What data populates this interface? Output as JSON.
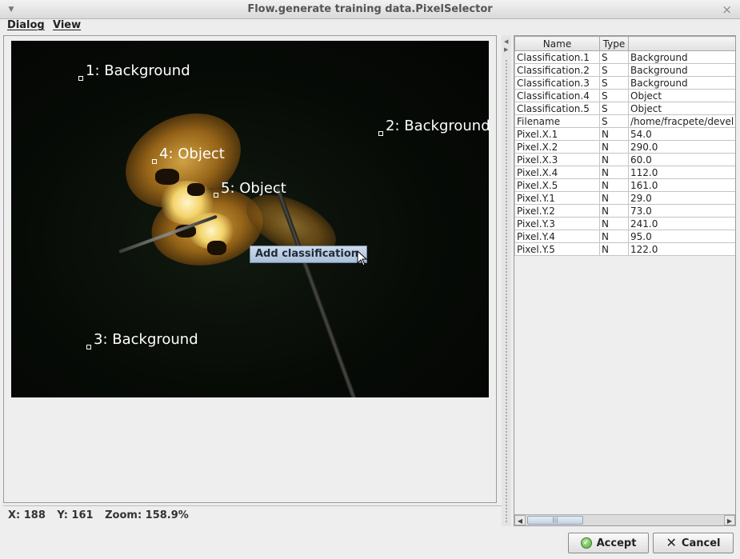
{
  "window": {
    "title": "Flow.generate training data.PixelSelector"
  },
  "menu": {
    "dialog_label": "Dialog",
    "view_label": "View"
  },
  "image": {
    "markers": [
      {
        "label": "1: Background"
      },
      {
        "label": "2: Background"
      },
      {
        "label": "3: Background"
      },
      {
        "label": "4: Object"
      },
      {
        "label": "5: Object"
      }
    ],
    "popup_label": "Add classification"
  },
  "status": {
    "x": "X: 188",
    "y": "Y: 161",
    "zoom": "Zoom: 158.9%"
  },
  "table": {
    "headers": [
      "Name",
      "Type",
      ""
    ],
    "rows": [
      [
        "Classification.1",
        "S",
        "Background"
      ],
      [
        "Classification.2",
        "S",
        "Background"
      ],
      [
        "Classification.3",
        "S",
        "Background"
      ],
      [
        "Classification.4",
        "S",
        "Object"
      ],
      [
        "Classification.5",
        "S",
        "Object"
      ],
      [
        "Filename",
        "S",
        "/home/fracpete/devel"
      ],
      [
        "Pixel.X.1",
        "N",
        "54.0"
      ],
      [
        "Pixel.X.2",
        "N",
        "290.0"
      ],
      [
        "Pixel.X.3",
        "N",
        "60.0"
      ],
      [
        "Pixel.X.4",
        "N",
        "112.0"
      ],
      [
        "Pixel.X.5",
        "N",
        "161.0"
      ],
      [
        "Pixel.Y.1",
        "N",
        "29.0"
      ],
      [
        "Pixel.Y.2",
        "N",
        "73.0"
      ],
      [
        "Pixel.Y.3",
        "N",
        "241.0"
      ],
      [
        "Pixel.Y.4",
        "N",
        "95.0"
      ],
      [
        "Pixel.Y.5",
        "N",
        "122.0"
      ]
    ]
  },
  "buttons": {
    "accept_label": "Accept",
    "cancel_label": "Cancel"
  },
  "icons": {
    "accept": "checkmark-icon",
    "cancel": "x-icon",
    "window_menu": "chevron-down-icon",
    "window_close": "close-icon"
  }
}
